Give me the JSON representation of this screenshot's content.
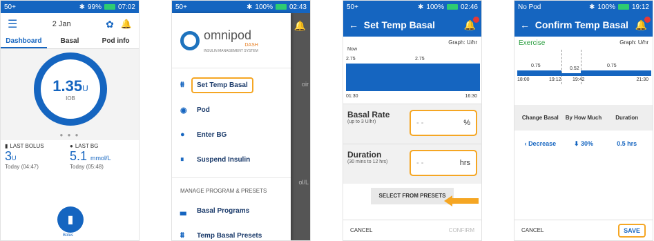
{
  "p1": {
    "status": {
      "left": "50+",
      "batt": "99%",
      "time": "07:02"
    },
    "date": "2 Jan",
    "tabs": [
      "Dashboard",
      "Basal",
      "Pod info"
    ],
    "iob_value": "1.35",
    "iob_unit": "U",
    "iob_label": "IOB",
    "last_bolus_label": "LAST BOLUS",
    "last_bolus_value": "3",
    "last_bolus_unit": "U",
    "last_bolus_time": "Today (04:47)",
    "last_bg_label": "LAST BG",
    "last_bg_value": "5.1",
    "last_bg_unit": "mmol/L",
    "last_bg_time": "Today (05:48)",
    "bolus_label": "Bolus"
  },
  "p2": {
    "status": {
      "left": "50+",
      "batt": "100%",
      "time": "02:43"
    },
    "logo": "omnipod",
    "logo_dash": "DASH",
    "logo_sub": "INSULIN MANAGEMENT SYSTEM",
    "menu": [
      {
        "label": "Set Temp Basal",
        "icon": "temp-basal-icon"
      },
      {
        "label": "Pod",
        "icon": "pod-icon"
      },
      {
        "label": "Enter BG",
        "icon": "drop-icon"
      },
      {
        "label": "Suspend Insulin",
        "icon": "pause-icon"
      }
    ],
    "section": "MANAGE PROGRAM & PRESETS",
    "menu2": [
      {
        "label": "Basal Programs",
        "icon": "basal-icon"
      },
      {
        "label": "Temp Basal Presets",
        "icon": "temp-basal-icon"
      }
    ],
    "bg_frag1": "oir",
    "bg_frag2": "ol/L"
  },
  "p3": {
    "status": {
      "left": "50+",
      "batt": "100%",
      "time": "02:46"
    },
    "title": "Set Temp Basal",
    "graph_label": "Graph: U/hr",
    "now": "Now",
    "rate1": "2.75",
    "rate2": "2.75",
    "t_start": "01:30",
    "t_end": "16:30",
    "basal_label": "Basal Rate",
    "basal_sub": "(up to 3 U/hr)",
    "basal_value": "- -",
    "basal_unit": "%",
    "dur_label": "Duration",
    "dur_sub": "(30 mins to 12 hrs)",
    "dur_value": "- -",
    "dur_unit": "hrs",
    "presets": "SELECT FROM PRESETS",
    "cancel": "CANCEL",
    "confirm": "CONFIRM",
    "accent": "#f5a623"
  },
  "p4": {
    "status": {
      "left": "No Pod",
      "batt": "100%",
      "time": "19:12"
    },
    "title": "Confirm Temp Basal",
    "preset": "Exercise",
    "graph_label": "Graph: U/hr",
    "r1": "0.75",
    "r2": "0.52",
    "r3": "0.75",
    "t1": "18:00",
    "t2": "19:12",
    "t3": "19:42",
    "t4": "21:30",
    "cols": [
      "Change Basal",
      "By How Much",
      "Duration"
    ],
    "change": "Decrease",
    "amount": "30%",
    "duration": "0.5 hrs",
    "cancel": "CANCEL",
    "save": "SAVE"
  }
}
